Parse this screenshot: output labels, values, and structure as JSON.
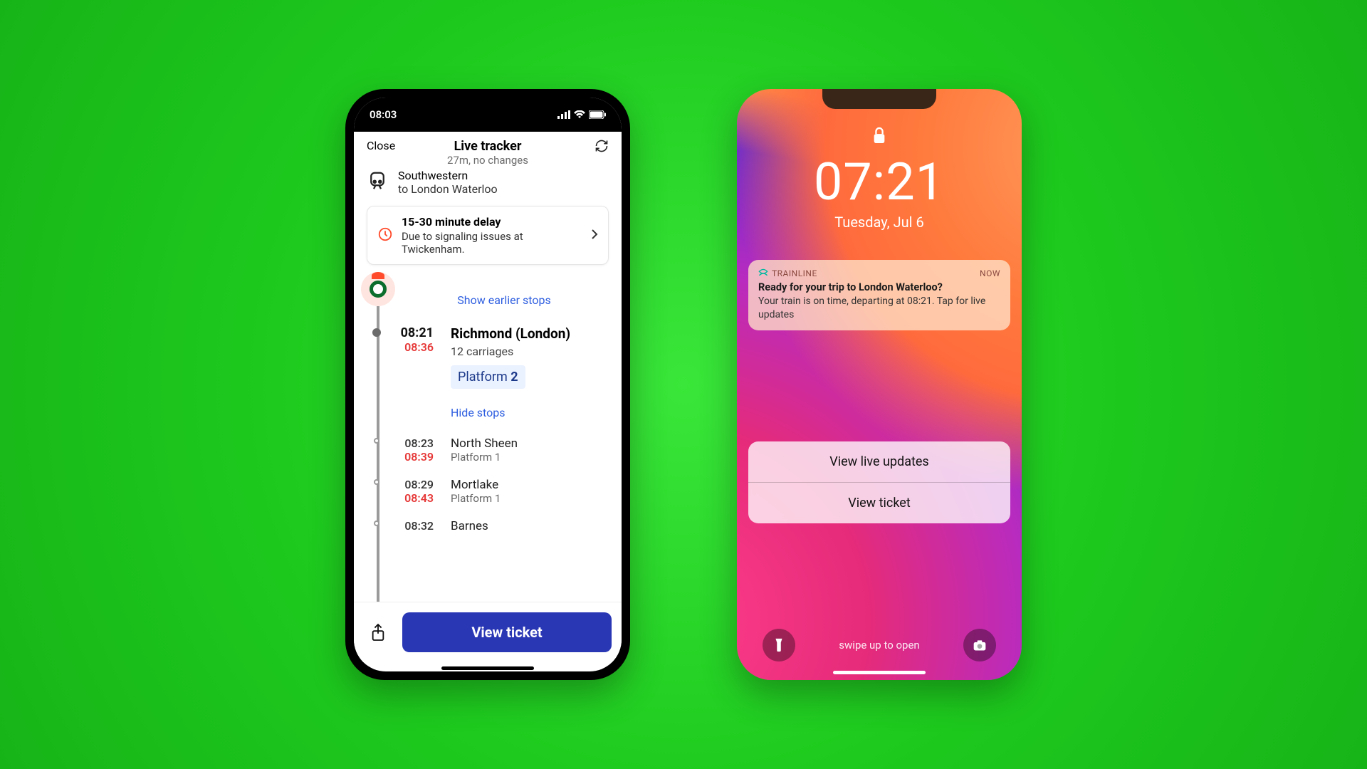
{
  "left": {
    "status_time": "08:03",
    "close": "Close",
    "title": "Live tracker",
    "subtitle": "27m, no changes",
    "operator_name": "Southwestern",
    "destination": "to London Waterloo",
    "delay": {
      "title": "15-30 minute delay",
      "reason": "Due to signaling issues at Twickenham."
    },
    "show_earlier": "Show earlier stops",
    "stop1": {
      "sched": "08:21",
      "delayed": "08:36",
      "name": "Richmond (London)",
      "carriages": "12 carriages",
      "platform_label": "Platform ",
      "platform_num": "2"
    },
    "hide_stops": "Hide stops",
    "stops": {
      "s2": {
        "sched": "08:23",
        "delayed": "08:39",
        "name": "North Sheen",
        "plat": "Platform 1"
      },
      "s3": {
        "sched": "08:29",
        "delayed": "08:43",
        "name": "Mortlake",
        "plat": "Platform 1"
      },
      "s4": {
        "sched": "08:32",
        "name": "Barnes"
      }
    },
    "view_ticket": "View ticket"
  },
  "right": {
    "time": "07:21",
    "date": "Tuesday, Jul 6",
    "notif": {
      "brand": "TRAINLINE",
      "when": "now",
      "title": "Ready for your trip to London Waterloo?",
      "body": "Your train is on time, departing at 08:21. Tap for live updates"
    },
    "action1": "View live updates",
    "action2": "View ticket",
    "swipe": "swipe up to open"
  }
}
